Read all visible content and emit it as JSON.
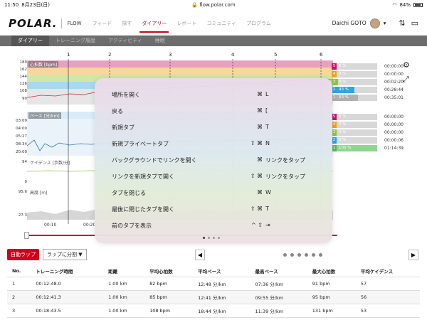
{
  "statusbar": {
    "time": "11:50",
    "date": "8月23日(日)",
    "url": "flow.polar.com",
    "battery": "84%"
  },
  "header": {
    "logo": "POLAR.",
    "brand": "FLOW",
    "nav": [
      "フィード",
      "探す",
      "ダイアリー",
      "レポート",
      "コミュニティ",
      "プログラム"
    ],
    "active_nav": 2,
    "user": "Daichi GOTO"
  },
  "subnav": {
    "items": [
      "ダイアリー",
      "トレーニング履歴",
      "アクティビティ",
      "睡眠"
    ],
    "active": 0
  },
  "laps_markers": [
    "1",
    "2",
    "3",
    "4",
    "5",
    "6"
  ],
  "panels": {
    "hr": {
      "label": "心拍数 [bpm]",
      "ticks": [
        "180",
        "162",
        "144",
        "126",
        "108",
        "90"
      ]
    },
    "pace": {
      "label": "ペース [分/km]",
      "ticks": [
        "03:09",
        "04:00",
        "05:27",
        "08:34",
        "20:00"
      ]
    },
    "cadence": {
      "label": "ケイデンス [歩数/分]",
      "ticks": [
        "94",
        "0"
      ]
    },
    "altitude": {
      "label": "高度 [m]",
      "ticks": [
        "95.6",
        "27.3"
      ]
    }
  },
  "x_ticks": [
    "00:10",
    "00:20"
  ],
  "hr_zones": [
    {
      "zone": "5",
      "pct": "0 %",
      "pct_value": 0,
      "time": "00:00:00",
      "color": "#c8166b"
    },
    {
      "zone": "4",
      "pct": "0 %",
      "pct_value": 0,
      "time": "00:00:00",
      "color": "#f0a11a"
    },
    {
      "zone": "3",
      "pct": "0 %",
      "pct_value": 0,
      "time": "00:02:20",
      "color": "#8cc63f"
    },
    {
      "zone": "2",
      "pct": "43 %",
      "pct_value": 43,
      "time": "00:28:44",
      "color": "#2ca6df"
    },
    {
      "zone": "1",
      "pct": "53 %",
      "pct_value": 53,
      "time": "00:35:01",
      "color": "#b0b0b0"
    }
  ],
  "pace_zones": [
    {
      "zone": "5",
      "pct": "0 %",
      "pct_value": 0,
      "time": "00:00:00",
      "color": "#c8166b"
    },
    {
      "zone": "4",
      "pct": "0 %",
      "pct_value": 0,
      "time": "00:00:00",
      "color": "#f0a11a"
    },
    {
      "zone": "3",
      "pct": "0 %",
      "pct_value": 0,
      "time": "00:00:00",
      "color": "#8cc63f"
    },
    {
      "zone": "2",
      "pct": "0 %",
      "pct_value": 0,
      "time": "00:00:06",
      "color": "#2ca6df"
    },
    {
      "zone": "1",
      "pct": "100 %",
      "pct_value": 100,
      "time": "01:14:39",
      "color": "#8fd68f"
    }
  ],
  "shortcut_popup": {
    "rows": [
      {
        "label": "場所を開く",
        "mods": "⌘",
        "key": "L"
      },
      {
        "label": "戻る",
        "mods": "⌘",
        "key": "["
      },
      {
        "label": "新規タブ",
        "mods": "⌘",
        "key": "T"
      },
      {
        "label": "新規プライベートタブ",
        "mods": "⇧ ⌘",
        "key": "N"
      },
      {
        "label": "バックグラウンドでリンクを開く",
        "mods": "⌘",
        "key": "リンクをタップ"
      },
      {
        "label": "リンクを新規タブで開く",
        "mods": "⇧ ⌘",
        "key": "リンクをタップ"
      },
      {
        "label": "タブを閉じる",
        "mods": "⌘",
        "key": "W"
      },
      {
        "label": "最後に閉じたタブを開く",
        "mods": "⇧ ⌘",
        "key": "T"
      },
      {
        "label": "前のタブを表示",
        "mods": "^ ⇧",
        "key": "⇥"
      }
    ],
    "pages": 4,
    "current_page": 0
  },
  "lap_controls": {
    "auto_lap": "自動ラップ",
    "split": "ラップに分割"
  },
  "lap_table": {
    "columns": [
      "No.",
      "トレーニング時間",
      "距離",
      "平均心拍数",
      "平均ペース",
      "最高ペース",
      "最大心拍数",
      "平均ケイデンス"
    ],
    "rows": [
      [
        "1",
        "00:12:48.0",
        "1.00 km",
        "82 bpm",
        "12:48 分/km",
        "07:36 分/km",
        "91 bpm",
        "57"
      ],
      [
        "2",
        "00:12:41.3",
        "1.00 km",
        "85 bpm",
        "12:41 分/km",
        "09:55 分/km",
        "95 bpm",
        "56"
      ],
      [
        "3",
        "00:18:43.5",
        "1.00 km",
        "108 bpm",
        "18:44 分/km",
        "11:39 分/km",
        "131 bpm",
        "53"
      ]
    ]
  }
}
